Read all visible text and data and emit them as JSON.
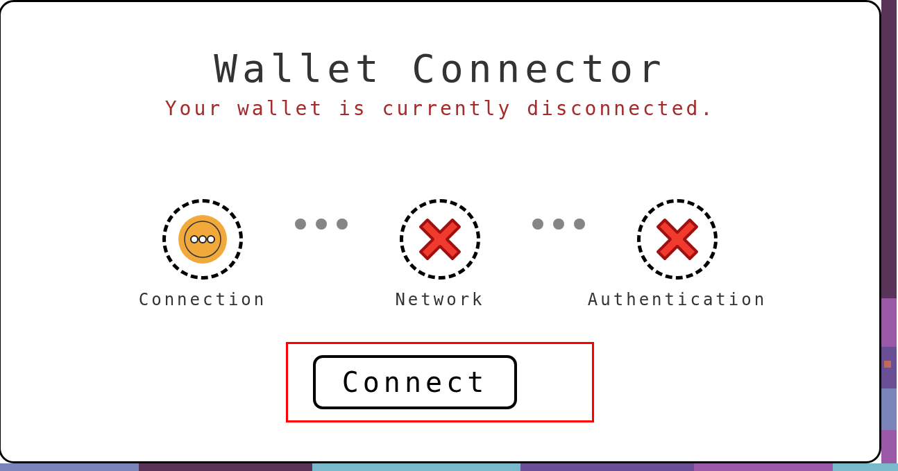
{
  "dialog": {
    "title": "Wallet Connector",
    "status": "Your wallet is currently disconnected.",
    "steps": [
      {
        "label": "Connection",
        "kind": "pending"
      },
      {
        "label": "Network",
        "kind": "failed"
      },
      {
        "label": "Authentication",
        "kind": "failed"
      }
    ],
    "button": "Connect",
    "button_highlighted": true
  }
}
